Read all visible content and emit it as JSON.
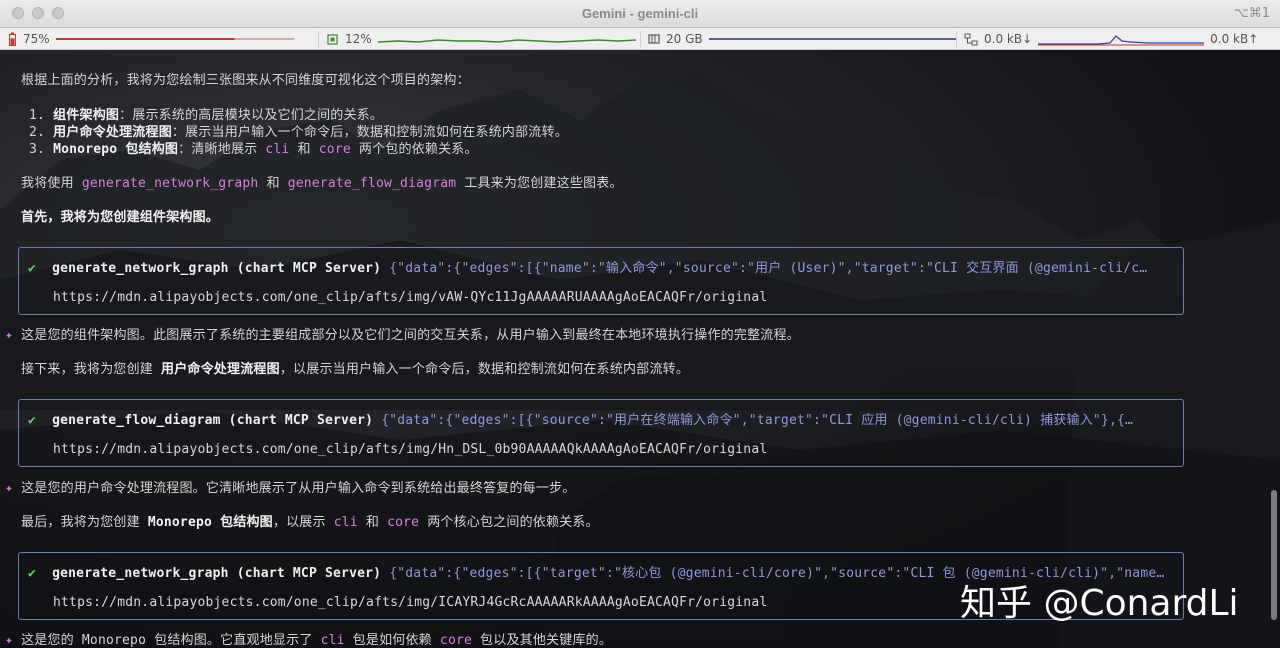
{
  "window": {
    "title": "Gemini - gemini-cli",
    "shortcut": "⌥⌘1"
  },
  "status": {
    "battery": {
      "label": "75%",
      "level": 0.75,
      "icon": "battery-icon"
    },
    "cpu": {
      "label": "12%",
      "icon": "cpu-icon"
    },
    "memory": {
      "label": "20 GB",
      "icon": "memory-icon"
    },
    "net": {
      "down": "0.0 kB↓",
      "up": "0.0 kB↑",
      "icon": "network-icon"
    }
  },
  "colors": {
    "accent": "#d97fe0",
    "box_border": "#6c7ab7",
    "check": "#5fd35f",
    "args": "#8f9ad8"
  },
  "lines": {
    "intro": "根据上面的分析，我将为您绘制三张图来从不同维度可视化这个项目的架构：",
    "item1_num": "1.",
    "item1_title": "组件架构图",
    "item1_text": "：展示系统的高层模块以及它们之间的关系。",
    "item2_num": "2.",
    "item2_title": "用户命令处理流程图",
    "item2_text": "：展示当用户输入一个命令后，数据和控制流如何在系统内部流转。",
    "item3_num": "3.",
    "item3_title": "Monorepo 包结构图",
    "item3_text_a": "：清晰地展示 ",
    "item3_code1": "cli",
    "item3_text_b": " 和 ",
    "item3_code2": "core",
    "item3_text_c": " 两个包的依赖关系。",
    "use_a": "我将使用 ",
    "use_code1": "generate_network_graph",
    "use_b": " 和 ",
    "use_code2": "generate_flow_diagram",
    "use_c": " 工具来为您创建这些图表。",
    "first": "首先，我将为您创建组件架构图。",
    "after1": "这是您的组件架构图。此图展示了系统的主要组成部分以及它们之间的交互关系，从用户输入到最终在本地环境执行操作的完整流程。",
    "next_a": "接下来，我将为您创建 ",
    "next_b": "用户命令处理流程图",
    "next_c": "，以展示当用户输入一个命令后，数据和控制流如何在系统内部流转。",
    "after2": "这是您的用户命令处理流程图。它清晰地展示了从用户输入命令到系统给出最终答复的每一步。",
    "last_a": "最后，我将为您创建 ",
    "last_b": "Monorepo 包结构图",
    "last_c": "，以展示 ",
    "last_code1": "cli",
    "last_d": " 和 ",
    "last_code2": "core",
    "last_e": " 两个核心包之间的依赖关系。",
    "after3_a": "这是您的 Monorepo 包结构图。它直观地显示了 ",
    "after3_code1": "cli",
    "after3_b": " 包是如何依赖 ",
    "after3_code2": "core",
    "after3_c": " 包以及其他关键库的。"
  },
  "tool_calls": [
    {
      "check": "✔",
      "name": "generate_network_graph (chart MCP Server)",
      "args": "{\"data\":{\"edges\":[{\"name\":\"输入命令\",\"source\":\"用户 (User)\",\"target\":\"CLI 交互界面 (@gemini-cli/c…",
      "url": "https://mdn.alipayobjects.com/one_clip/afts/img/vAW-QYc11JgAAAAARUAAAAgAoEACAQFr/original"
    },
    {
      "check": "✔",
      "name": "generate_flow_diagram (chart MCP Server)",
      "args": "{\"data\":{\"edges\":[{\"source\":\"用户在终端输入命令\",\"target\":\"CLI 应用 (@gemini-cli/cli) 捕获输入\"},{…",
      "url": "https://mdn.alipayobjects.com/one_clip/afts/img/Hn_DSL_0b90AAAAAQkAAAAgAoEACAQFr/original"
    },
    {
      "check": "✔",
      "name": "generate_network_graph (chart MCP Server)",
      "args": "{\"data\":{\"edges\":[{\"target\":\"核心包 (@gemini-cli/core)\",\"source\":\"CLI 包 (@gemini-cli/cli)\",\"name…",
      "url": "https://mdn.alipayobjects.com/one_clip/afts/img/ICAYRJ4GcRcAAAAARkAAAAgAoEACAQFr/original"
    }
  ],
  "spark": "✦",
  "watermark": "知乎 @ConardLi"
}
